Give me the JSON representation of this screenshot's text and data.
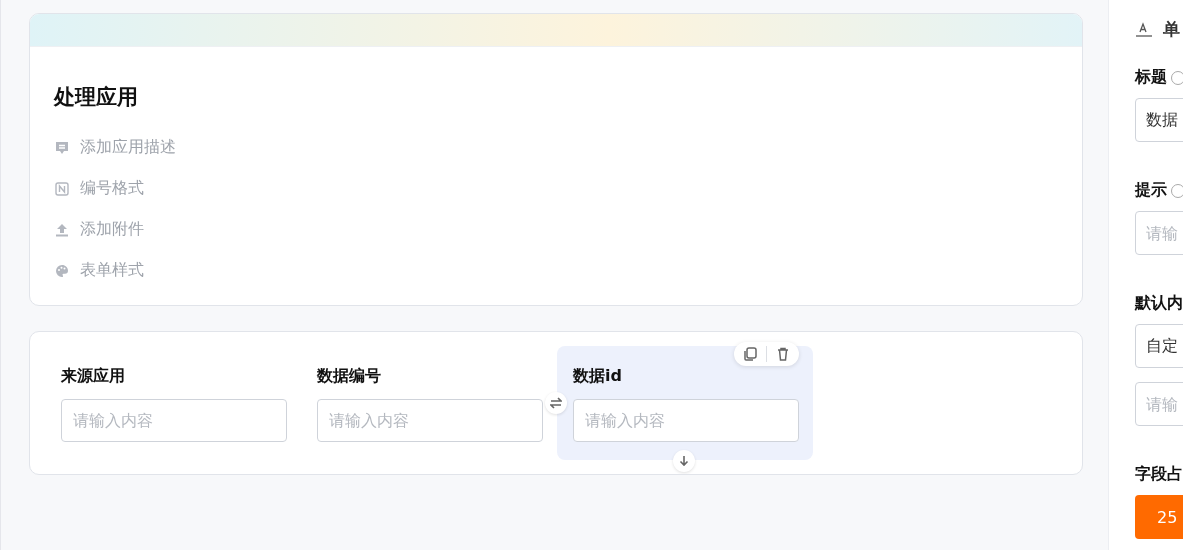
{
  "app_card": {
    "title": "处理应用",
    "actions": [
      {
        "kind": "description",
        "label": "添加应用描述"
      },
      {
        "kind": "numbering",
        "label": "编号格式"
      },
      {
        "kind": "attachment",
        "label": "添加附件"
      },
      {
        "kind": "style",
        "label": "表单样式"
      }
    ]
  },
  "form_fields": [
    {
      "label": "来源应用",
      "placeholder": "请输入内容",
      "selected": false
    },
    {
      "label": "数据编号",
      "placeholder": "请输入内容",
      "selected": false
    },
    {
      "label": "数据id",
      "placeholder": "请输入内容",
      "selected": true
    }
  ],
  "properties_panel": {
    "heading": "单",
    "sections": [
      {
        "kind": "text",
        "label": "标题",
        "help": true,
        "value": "数据"
      },
      {
        "kind": "text",
        "label": "提示",
        "help": true,
        "placeholder": "请输"
      },
      {
        "kind": "default",
        "label": "默认内",
        "value": "自定",
        "placeholder": "请输"
      },
      {
        "kind": "width",
        "label": "字段占",
        "value": "25"
      }
    ]
  }
}
